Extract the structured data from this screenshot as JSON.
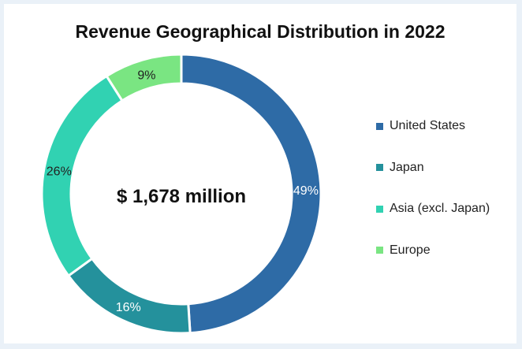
{
  "chart_data": {
    "type": "pie",
    "variant": "doughnut",
    "title": "Revenue Geographical Distribution in 2022",
    "center_label": "$ 1,678 million",
    "categories": [
      "United States",
      "Japan",
      "Asia (excl. Japan)",
      "Europe"
    ],
    "values": [
      49,
      16,
      26,
      9
    ],
    "value_labels": [
      "49%",
      "16%",
      "26%",
      "9%"
    ],
    "unit": "%",
    "colors": [
      "#2e6ba6",
      "#24919c",
      "#31d2b2",
      "#7ae582"
    ],
    "label_colors": [
      "#ffffff",
      "#ffffff",
      "#222222",
      "#222222"
    ],
    "legend_position": "right",
    "start_angle": "12 o'clock",
    "direction": "clockwise"
  }
}
